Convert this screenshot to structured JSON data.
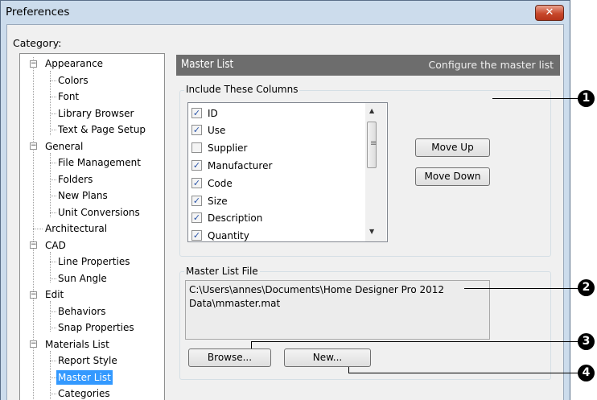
{
  "window": {
    "title": "Preferences",
    "close_glyph": "✕"
  },
  "category_label": "Category:",
  "tree": {
    "appearance": {
      "label": "Appearance",
      "toggle": "−",
      "children": [
        "Colors",
        "Font",
        "Library Browser",
        "Text & Page Setup"
      ]
    },
    "general": {
      "label": "General",
      "toggle": "−",
      "children": [
        "File Management",
        "Folders",
        "New Plans",
        "Unit Conversions"
      ]
    },
    "architectural": {
      "label": "Architectural"
    },
    "cad": {
      "label": "CAD",
      "toggle": "−",
      "children": [
        "Line Properties",
        "Sun Angle"
      ]
    },
    "edit": {
      "label": "Edit",
      "toggle": "−",
      "children": [
        "Behaviors",
        "Snap Properties"
      ]
    },
    "materials": {
      "label": "Materials List",
      "toggle": "−",
      "children": [
        "Report Style",
        "Master List",
        "Categories"
      ],
      "selected": "Master List"
    }
  },
  "header": {
    "title": "Master List",
    "description": "Configure the master list"
  },
  "columns_group": {
    "label": "Include These Columns",
    "items": [
      {
        "label": "ID",
        "checked": true
      },
      {
        "label": "Use",
        "checked": true
      },
      {
        "label": "Supplier",
        "checked": false
      },
      {
        "label": "Manufacturer",
        "checked": true
      },
      {
        "label": "Code",
        "checked": true
      },
      {
        "label": "Size",
        "checked": true
      },
      {
        "label": "Description",
        "checked": true
      },
      {
        "label": "Quantity",
        "checked": true
      }
    ],
    "check_glyph": "✓"
  },
  "buttons": {
    "move_up": "Move Up",
    "move_down": "Move Down",
    "browse": "Browse...",
    "new": "New..."
  },
  "file_group": {
    "label": "Master List File",
    "path_line1": "C:\\Users\\annes\\Documents\\Home Designer Pro 2012",
    "path_line2": "Data\\mmaster.mat"
  },
  "callouts": [
    "1",
    "2",
    "3",
    "4"
  ],
  "scroll": {
    "up_arrow": "▲",
    "down_arrow": "▼",
    "grip": "≡"
  },
  "colors": {
    "title_bar": "#ccdcec",
    "header_bar": "#6d6d6d",
    "selection": "#3399ff",
    "close_button": "#c8482c"
  }
}
